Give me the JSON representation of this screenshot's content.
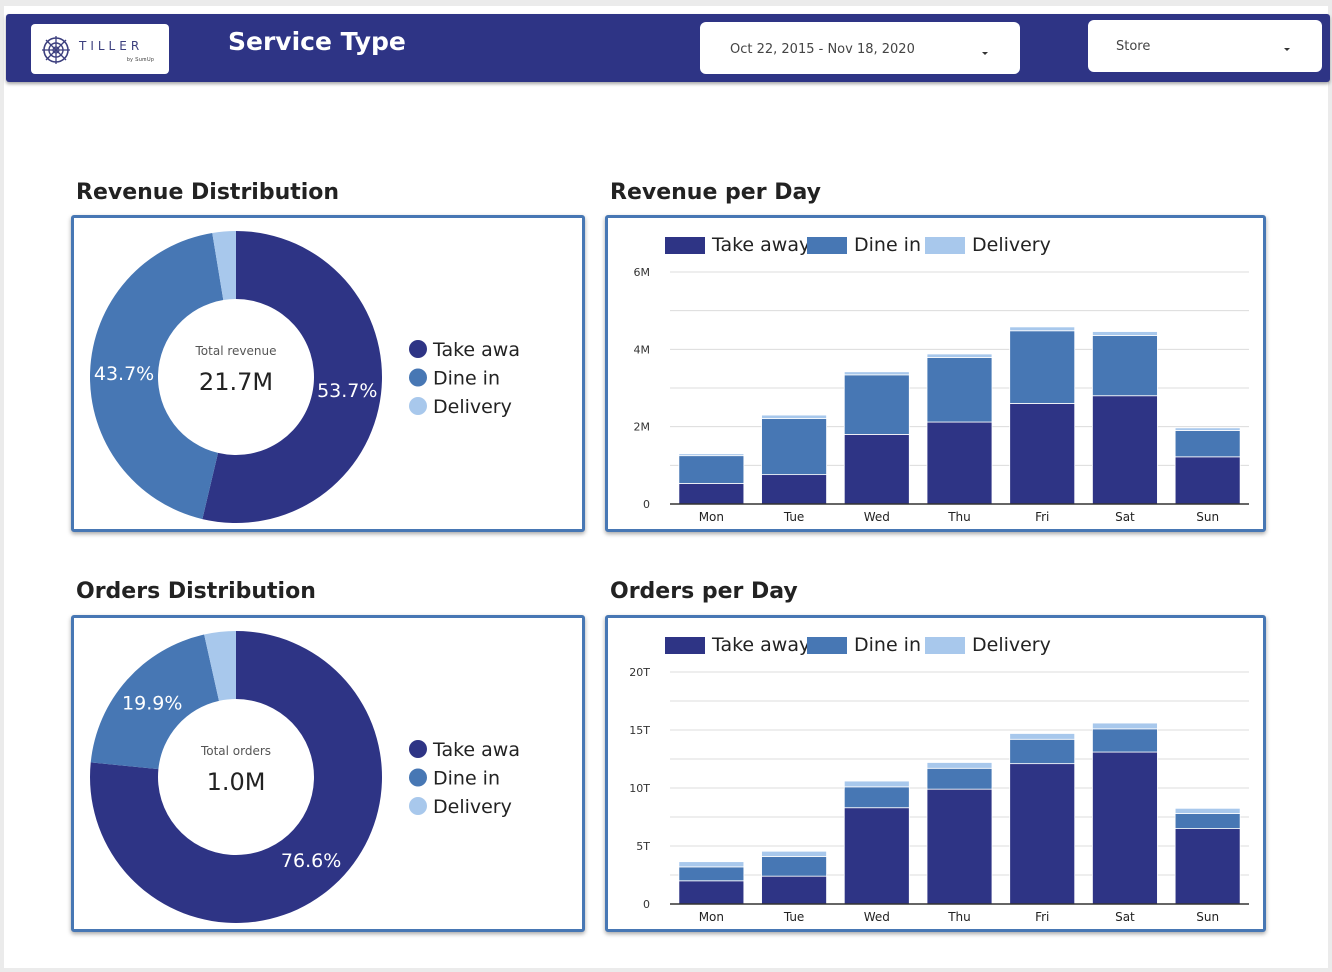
{
  "header": {
    "logo_text": "TILLER",
    "logo_subtext": "by SumUp",
    "title": "Service Type",
    "date_range": "Oct 22, 2015 - Nov 18, 2020",
    "store_label": "Store"
  },
  "colors": {
    "take_away": "#2e3485",
    "dine_in": "#4777b4",
    "delivery": "#a8c8ec",
    "header_bg": "#2e3485"
  },
  "sections": {
    "revenue_distribution": "Revenue Distribution",
    "revenue_per_day": "Revenue per Day",
    "orders_distribution": "Orders Distribution",
    "orders_per_day": "Orders per Day"
  },
  "chart_data": [
    {
      "id": "revenue_distribution",
      "type": "pie",
      "title": "Revenue Distribution",
      "center_label": "Total revenue",
      "center_value": "21.7M",
      "legend_labels": [
        "Take awa",
        "Dine in",
        "Delivery"
      ],
      "slices": [
        {
          "name": "Take away",
          "value": 53.7,
          "label": "53.7%"
        },
        {
          "name": "Dine in",
          "value": 43.7,
          "label": "43.7%"
        },
        {
          "name": "Delivery",
          "value": 2.6,
          "label": ""
        }
      ]
    },
    {
      "id": "revenue_per_day",
      "type": "bar",
      "stacked": true,
      "title": "Revenue per Day",
      "legend_labels": [
        "Take away",
        "Dine in",
        "Delivery"
      ],
      "categories": [
        "Mon",
        "Tue",
        "Wed",
        "Thu",
        "Fri",
        "Sat",
        "Sun"
      ],
      "series": [
        {
          "name": "Take away",
          "values": [
            0.53,
            0.76,
            1.8,
            2.12,
            2.6,
            2.8,
            1.22
          ]
        },
        {
          "name": "Dine in",
          "values": [
            0.72,
            1.45,
            1.54,
            1.67,
            1.88,
            1.56,
            0.68
          ]
        },
        {
          "name": "Delivery",
          "values": [
            0.05,
            0.09,
            0.08,
            0.09,
            0.1,
            0.1,
            0.07
          ]
        }
      ],
      "ylim": [
        0,
        6
      ],
      "yticks": [
        0,
        2,
        4,
        6
      ],
      "ytick_labels": [
        "0",
        "2M",
        "4M",
        "6M"
      ],
      "gridlines": [
        0,
        1,
        2,
        3,
        4,
        5,
        6
      ]
    },
    {
      "id": "orders_distribution",
      "type": "pie",
      "title": "Orders Distribution",
      "center_label": "Total orders",
      "center_value": "1.0M",
      "legend_labels": [
        "Take awa",
        "Dine in",
        "Delivery"
      ],
      "slices": [
        {
          "name": "Take away",
          "value": 76.6,
          "label": "76.6%"
        },
        {
          "name": "Dine in",
          "value": 19.9,
          "label": "19.9%"
        },
        {
          "name": "Delivery",
          "value": 3.5,
          "label": ""
        }
      ]
    },
    {
      "id": "orders_per_day",
      "type": "bar",
      "stacked": true,
      "title": "Orders per Day",
      "legend_labels": [
        "Take away",
        "Dine in",
        "Delivery"
      ],
      "categories": [
        "Mon",
        "Tue",
        "Wed",
        "Thu",
        "Fri",
        "Sat",
        "Sun"
      ],
      "series": [
        {
          "name": "Take away",
          "values": [
            2.0,
            2.4,
            8.3,
            9.9,
            12.1,
            13.1,
            6.5
          ]
        },
        {
          "name": "Dine in",
          "values": [
            1.2,
            1.7,
            1.8,
            1.8,
            2.1,
            2.0,
            1.3
          ]
        },
        {
          "name": "Delivery",
          "values": [
            0.45,
            0.45,
            0.5,
            0.5,
            0.5,
            0.5,
            0.45
          ]
        }
      ],
      "ylim": [
        0,
        20
      ],
      "yticks": [
        0,
        5,
        10,
        15,
        20
      ],
      "ytick_labels": [
        "0",
        "5T",
        "10T",
        "15T",
        "20T"
      ],
      "gridlines": [
        0,
        2.5,
        5,
        7.5,
        10,
        12.5,
        15,
        17.5,
        20
      ]
    }
  ]
}
